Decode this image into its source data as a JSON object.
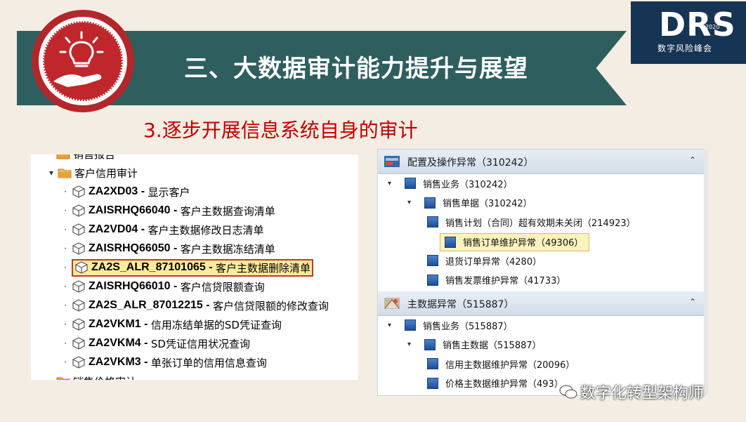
{
  "banner": {
    "title": "三、大数据审计能力提升与展望"
  },
  "logo": {
    "main": "DRS",
    "year": "2020",
    "sub": "数字风险峰会"
  },
  "subtitle": "3.逐步开展信息系统自身的审计",
  "left_tree": {
    "top_partial": "销售报告",
    "folder_label": "客户信用审计",
    "items": [
      {
        "code": "ZA2XD03",
        "desc": "显示客户"
      },
      {
        "code": "ZAISRHQ66040",
        "desc": "客户主数据查询清单"
      },
      {
        "code": "ZA2VD04",
        "desc": "客户主数据修改日志清单"
      },
      {
        "code": "ZAISRHQ66050",
        "desc": "客户主数据冻结清单"
      },
      {
        "code": "ZA2S_ALR_87101065",
        "desc": "客户主数据删除清单"
      },
      {
        "code": "ZAISRHQ66010",
        "desc": "客户信贷限额查询"
      },
      {
        "code": "ZA2S_ALR_87012215",
        "desc": "客户信贷限额的修改查询"
      },
      {
        "code": "ZA2VKM1",
        "desc": "信用冻结单据的SD凭证查询"
      },
      {
        "code": "ZA2VKM4",
        "desc": "SD凭证信用状况查询"
      },
      {
        "code": "ZA2VKM3",
        "desc": "单张订单的信用信息查询"
      }
    ],
    "separator": " - ",
    "bottom_partial": "销售价格审计"
  },
  "right_panel": {
    "sections": [
      {
        "title": "配置及操作异常（310242）",
        "rows": [
          {
            "label": "销售业务（310242）"
          },
          {
            "label": "销售单据（310242）"
          },
          {
            "label": "销售计划（合同）超有效期未关闭（214923）"
          },
          {
            "label": "销售订单维护异常（49306）"
          },
          {
            "label": "退货订单异常（4280）"
          },
          {
            "label": "销售发票维护异常（41733）"
          }
        ]
      },
      {
        "title": "主数据异常（515887）",
        "rows": [
          {
            "label": "销售业务（515887）"
          },
          {
            "label": "销售主数据（515887）"
          },
          {
            "label": "信用主数据维护异常（20096）"
          },
          {
            "label": "价格主数据维护异常（493）"
          }
        ]
      }
    ]
  },
  "watermark": "数字化转型架构师"
}
